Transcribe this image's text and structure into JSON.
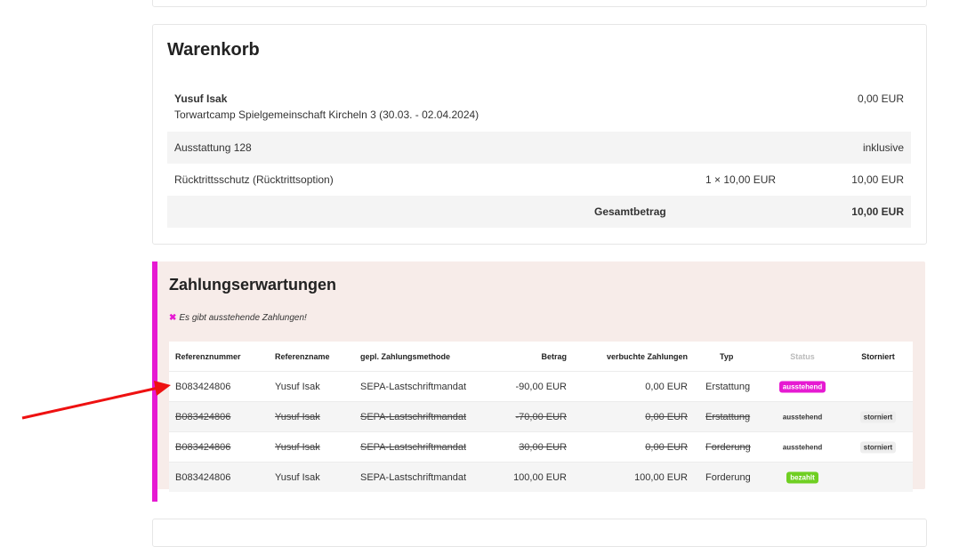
{
  "cart": {
    "title": "Warenkorb",
    "participant_name": "Yusuf Isak",
    "event": "Torwartcamp Spielgemeinschaft Kircheln 3 (30.03. - 02.04.2024)",
    "event_amount": "0,00 EUR",
    "items": [
      {
        "label": "Ausstattung 128",
        "qty": "",
        "amount": "inklusive"
      },
      {
        "label": "Rücktrittsschutz (Rücktrittsoption)",
        "qty": "1 × 10,00 EUR",
        "amount": "10,00 EUR"
      }
    ],
    "total_label": "Gesamtbetrag",
    "total_amount": "10,00 EUR"
  },
  "payments": {
    "title": "Zahlungserwartungen",
    "notice": "Es gibt ausstehende Zahlungen!",
    "columns": {
      "ref": "Referenznummer",
      "name": "Referenzname",
      "method": "gepl. Zahlungsmethode",
      "amount": "Betrag",
      "booked": "verbuchte Zahlungen",
      "type": "Typ",
      "status": "Status",
      "cancelled": "Storniert"
    },
    "rows": [
      {
        "ref": "B083424806",
        "name": "Yusuf Isak",
        "method": "SEPA-Lastschriftmandat",
        "amount": "-90,00 EUR",
        "booked": "0,00 EUR",
        "type": "Erstattung",
        "status": "ausstehend",
        "cancelled": ""
      },
      {
        "ref": "B083424806",
        "name": "Yusuf Isak",
        "method": "SEPA-Lastschriftmandat",
        "amount": "-70,00 EUR",
        "booked": "0,00 EUR",
        "type": "Erstattung",
        "status": "ausstehend",
        "cancelled": "storniert"
      },
      {
        "ref": "B083424806",
        "name": "Yusuf Isak",
        "method": "SEPA-Lastschriftmandat",
        "amount": "30,00 EUR",
        "booked": "0,00 EUR",
        "type": "Forderung",
        "status": "ausstehend",
        "cancelled": "storniert"
      },
      {
        "ref": "B083424806",
        "name": "Yusuf Isak",
        "method": "SEPA-Lastschriftmandat",
        "amount": "100,00 EUR",
        "booked": "100,00 EUR",
        "type": "Forderung",
        "status": "bezahlt",
        "cancelled": ""
      }
    ]
  },
  "colors": {
    "accent": "#e61ad2",
    "paid": "#6fcf22",
    "panel_bg": "#f7ece9",
    "annotation_arrow": "#ee1111"
  },
  "icons": {
    "notice_icon": "close-x-icon"
  }
}
